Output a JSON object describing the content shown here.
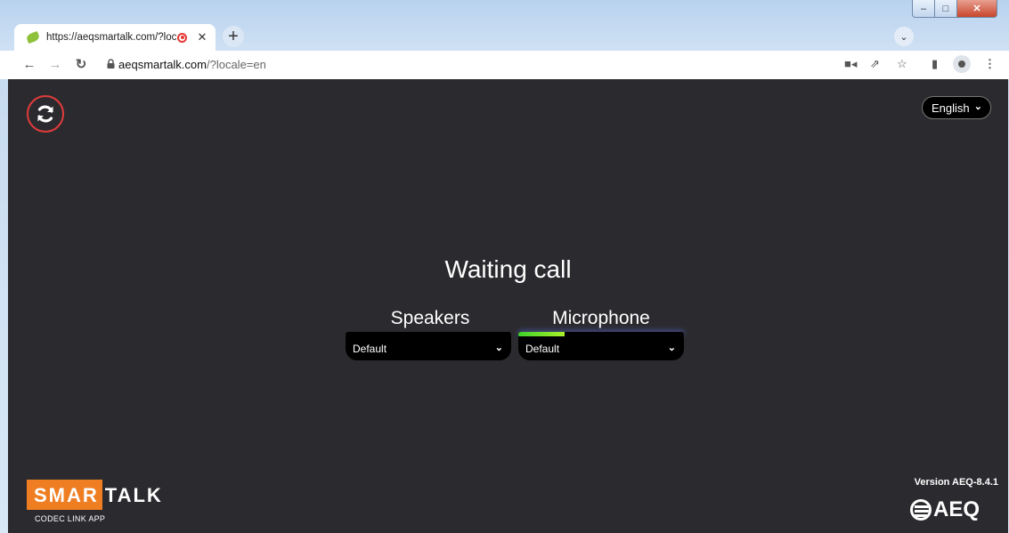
{
  "browser": {
    "tab_title": "https://aeqsmartalk.com/?loc",
    "tab_close": "✕",
    "new_tab": "+",
    "tab_search": "⌄",
    "url_host": "aeqsmartalk.com",
    "url_path": "/?locale=en",
    "window_controls": {
      "minimize": "–",
      "maximize": "□",
      "close": "✕"
    }
  },
  "app": {
    "language": "English",
    "status": "Waiting call",
    "speakers": {
      "label": "Speakers",
      "device": "Default",
      "level": 0.0
    },
    "microphone": {
      "label": "Microphone",
      "device": "Default",
      "level": 0.28
    },
    "version": "Version AEQ-8.4.1",
    "logo": {
      "part1": "SMAR",
      "part2": "TALK",
      "subtitle": "CODEC LINK APP"
    },
    "brand": "AEQ"
  },
  "colors": {
    "page_bg": "#2b2b2f",
    "accent_orange": "#ef7d22",
    "refresh_ring": "#e23b3b",
    "meter_green": "#3fd12b"
  },
  "icons": [
    "refresh-icon",
    "lock-icon",
    "camera-icon",
    "share-icon",
    "star-icon",
    "side-panel-icon",
    "profile-icon",
    "menu-icon",
    "chevron-down-icon",
    "record-icon"
  ]
}
